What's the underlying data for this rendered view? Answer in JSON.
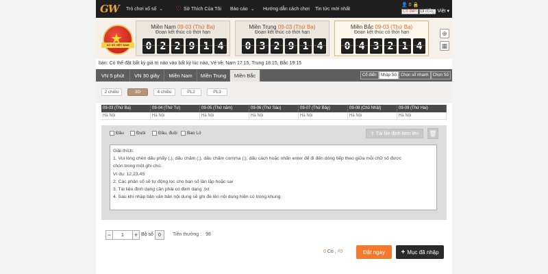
{
  "nav": {
    "logo": "GW",
    "items": [
      {
        "label": "Trò chơi xổ số",
        "chevron": true
      },
      {
        "label": "Sở Thích Của Tôi",
        "chevron": false
      },
      {
        "label": "Báo cáo",
        "chevron": true
      },
      {
        "label": "Hướng dẫn cách chơi",
        "chevron": false
      },
      {
        "label": "Tin tức mới nhất",
        "chevron": false
      }
    ],
    "account": {
      "balance": "0",
      "mode_classic": "Cổ điển",
      "mode_mobile": "Di động",
      "language": "tiếng Việt"
    }
  },
  "regions": [
    {
      "name": "Miền Nam",
      "date": "09-03 (Thứ Ba)",
      "status": "Đoạn kết thúc có thời hạn",
      "digits": [
        "0",
        "2",
        "2",
        "9",
        "1",
        "4"
      ],
      "active": false
    },
    {
      "name": "Miền Trung",
      "date": "09-03 (Thứ Ba)",
      "status": "Đoạn kết thúc có thời hạn",
      "digits": [
        "0",
        "3",
        "2",
        "9",
        "1",
        "4"
      ],
      "active": false
    },
    {
      "name": "Miền Bắc",
      "date": "09-03 (Thứ Ba)",
      "status": "Đoạn kết thúc có thời hạn",
      "digits": [
        "0",
        "4",
        "3",
        "2",
        "1",
        "4"
      ],
      "active": true
    }
  ],
  "notice": "bán: Có thể đặt bất kỳ giá trị nào vào bất kỳ lúc nào,    Vé về: Nam 17:15, Trung 18:15, Bắc 19:15",
  "game_tabs": [
    "VN 5 phút",
    "VN 30 giây",
    "Miền Nam",
    "Miền Trung",
    "Miền Bắc"
  ],
  "active_game_tab": "Miền Bắc",
  "mode_buttons": [
    "Cổ điển",
    "Nhập Số",
    "Chọn số nhanh",
    "Chọn Số"
  ],
  "active_mode": "Nhập Số",
  "sub_tabs": [
    "2 chiều",
    "3D",
    "4 chiều",
    "PL2",
    "PL3"
  ],
  "active_sub_tab": "3D",
  "dates": [
    {
      "date": "09-03 (Thứ Ba)",
      "place": "Hà Nội"
    },
    {
      "date": "09-04 (Thứ Tư)",
      "place": "Hà Nội"
    },
    {
      "date": "09-05 (Thứ năm)",
      "place": "Hà Nội"
    },
    {
      "date": "09-06 (Thứ Sáu)",
      "place": "Hà Nội"
    },
    {
      "date": "09-07 (Thứ Bảy)",
      "place": "Hà Nội"
    },
    {
      "date": "09-08 (Chủ Nhật)",
      "place": "Hà Nội"
    },
    {
      "date": "09-09 (Thứ Hai)",
      "place": "Hà Nội"
    }
  ],
  "checkboxes": [
    "Đầu",
    "Đuôi",
    "Đầu, đuôi",
    "Bao Lô"
  ],
  "upload_label": "Tải file định kèm lên",
  "explanation": [
    "Giải thích:",
    "1. Vui lòng chèn dấu phẩy (,), dấu chấm (;), dấu chấm comma (;), dấu cách hoặc nhấn enter để đi đến dòng tiếp theo giữa mỗi chữ số được",
    "chọn trong một ghi chú.",
    "Ví dụ: 12,23,45",
    "2. Các phân số sẽ tự động lọc cho bạn số lần lặp hoặc sai",
    "3. Tài liệu định dạng cần phải có định dạng .txt",
    "4. Sau khi nhập bản văn bản nội dung sẽ ghi đè lên nội dung hiện có trong khung"
  ],
  "stepper": {
    "minus": "−",
    "value": "1",
    "plus": "+"
  },
  "bo_so_label": "Bộ số",
  "bo_so_value": "0",
  "tien_thuong_label": "Tiền thưởng :",
  "tien_thuong_value": "98",
  "summary": {
    "count": "0",
    "count_label": "Cò ,",
    "amount": "0"
  },
  "bet_button": "Đặt ngay",
  "list_button": "Mục đã nhập"
}
